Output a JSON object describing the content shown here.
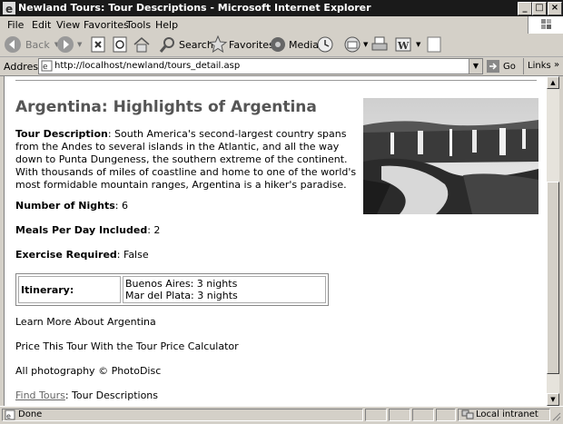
{
  "window": {
    "title": "Newland Tours: Tour Descriptions - Microsoft Internet Explorer"
  },
  "menu": [
    "File",
    "Edit",
    "View",
    "Favorites",
    "Tools",
    "Help"
  ],
  "toolbar": {
    "back": "Back",
    "search": "Search",
    "favorites": "Favorites",
    "media": "Media"
  },
  "address": {
    "label": "Address",
    "url": "http://localhost/newland/tours_detail.asp",
    "go": "Go",
    "links": "Links"
  },
  "page": {
    "heading": "Argentina: Highlights of Argentina",
    "description_label": "Tour Description",
    "description_text": ": South America's second-largest country spans from the Andes to several islands in the Atlantic, and all the way down to Punta Dungeness, the southern extreme of the continent. With thousands of miles of coastline and home to one of the world's most formidable mountain ranges, Argentina is a hiker's paradise.",
    "nights_label": "Number of Nights",
    "nights_value": ": 6",
    "meals_label": "Meals Per Day Included",
    "meals_value": ": 2",
    "exercise_label": "Exercise Required",
    "exercise_value": ": False",
    "itinerary_label": "Itinerary:",
    "itinerary_line1": "Buenos Aires: 3 nights",
    "itinerary_line2": "Mar del Plata: 3 nights",
    "learn_more": "Learn More About Argentina",
    "price_tour": "Price This Tour With the Tour Price Calculator",
    "photo_credit": "All photography © PhotoDisc",
    "breadcrumb_link": "Find Tours",
    "breadcrumb_current": ": Tour Descriptions"
  },
  "status": {
    "text": "Done",
    "zone": "Local intranet"
  }
}
